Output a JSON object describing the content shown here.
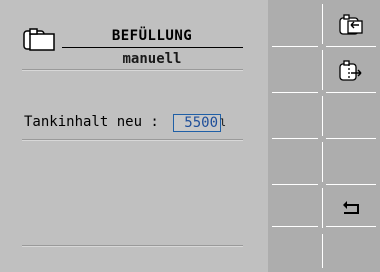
{
  "header": {
    "title": "BEFÜLLUNG",
    "subtitle": "manuell",
    "icon": "tank-icon"
  },
  "form": {
    "tank_label": "Tankinhalt neu :",
    "tank_value": "5500",
    "tank_unit": "l"
  },
  "softkeys": [
    {
      "id": "fill-tank",
      "icon": "tank-fill-icon"
    },
    {
      "id": "empty-tank",
      "icon": "tank-empty-icon"
    },
    {
      "id": "empty-slot-3",
      "icon": ""
    },
    {
      "id": "empty-slot-4",
      "icon": ""
    },
    {
      "id": "back",
      "icon": "return-arrow-icon"
    },
    {
      "id": "empty-slot-6",
      "icon": ""
    }
  ],
  "colors": {
    "screen_bg": "#c0c0c0",
    "softkey_bg": "#adadad",
    "input_accent": "#1f5fa6"
  }
}
